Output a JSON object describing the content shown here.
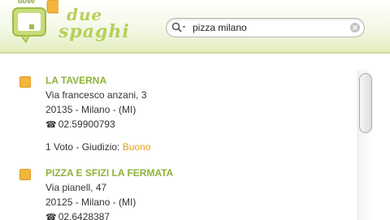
{
  "header": {
    "logo_top": "dove",
    "logo_word1": "due",
    "logo_word2": "spaghi"
  },
  "search": {
    "value": "pizza milano",
    "icon": "search-icon",
    "clear_icon": "clear-icon"
  },
  "results": [
    {
      "name": "LA TAVERNA",
      "address": "Via francesco anzani, 3",
      "city": "20135 - Milano - (MI)",
      "phone": "02.59900793",
      "votes": "1 Voto - Giudizio:",
      "rating": "Buono"
    },
    {
      "name": "PIZZA E SFIZI LA FERMATA",
      "address": "Via pianell, 47",
      "city": "20125 - Milano - (MI)",
      "phone": "02.6428387"
    }
  ],
  "colors": {
    "accent": "#8fb339",
    "marker": "#f2b53d",
    "rating": "#e0a21d"
  }
}
